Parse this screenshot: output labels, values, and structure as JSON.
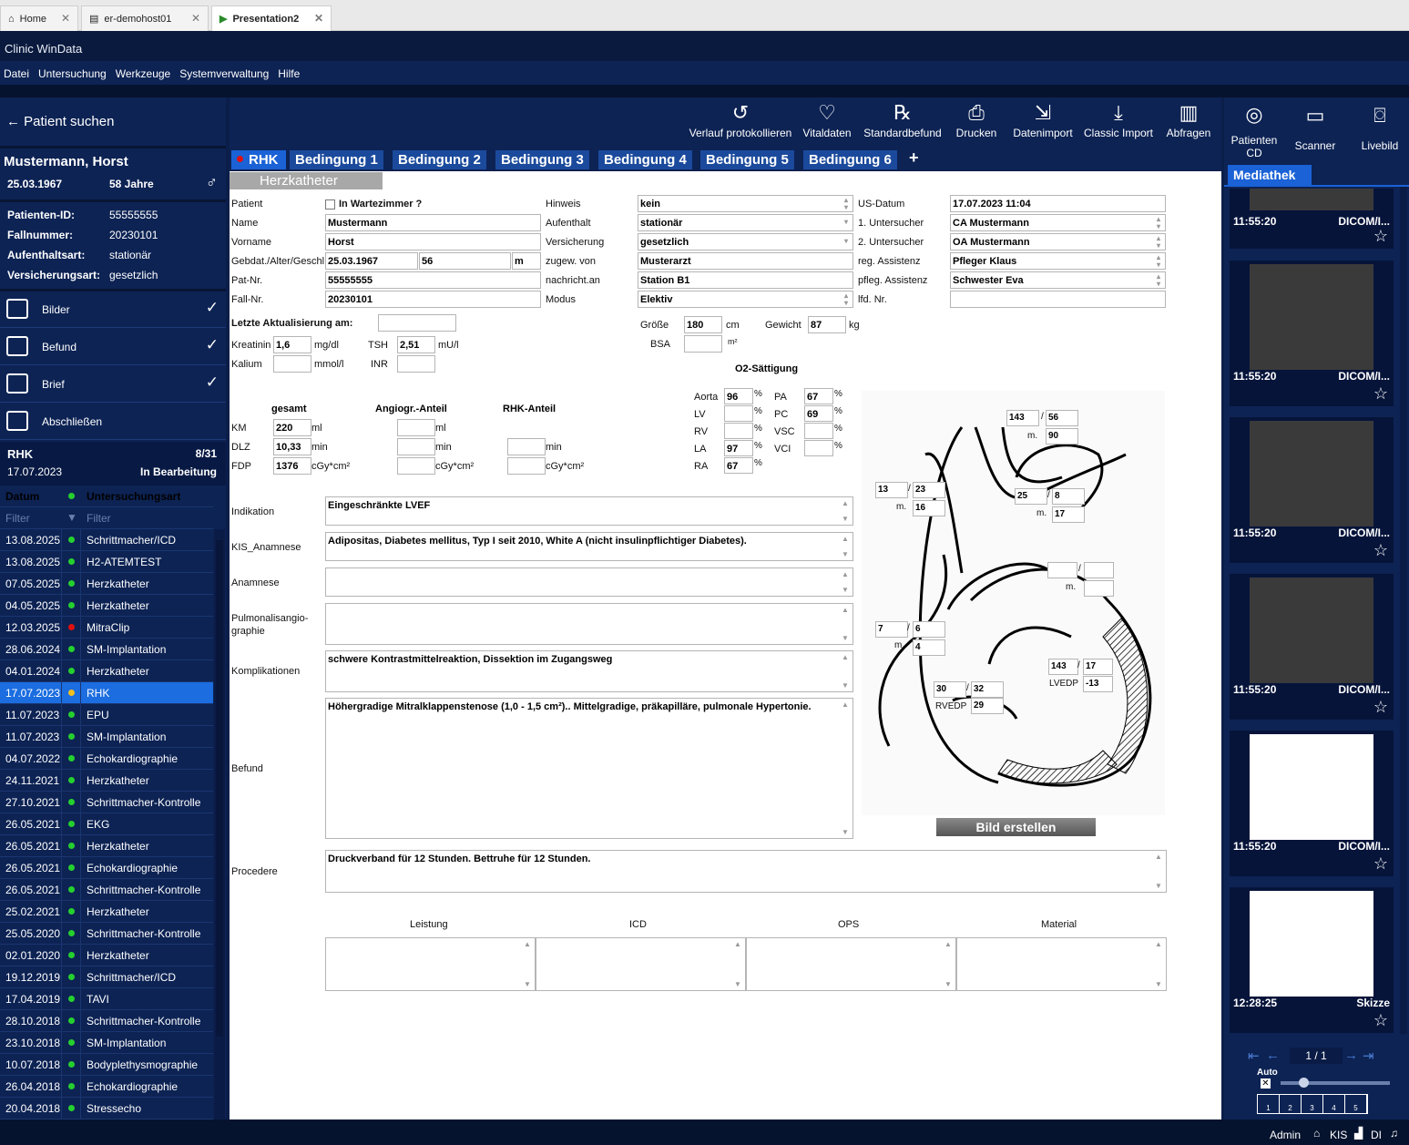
{
  "browser_tabs": [
    {
      "label": "Home"
    },
    {
      "label": "er-demohost01"
    },
    {
      "label": "Presentation2"
    }
  ],
  "app_title": "Clinic WinData",
  "menu": [
    "Datei",
    "Untersuchung",
    "Werkzeuge",
    "Systemverwaltung",
    "Hilfe"
  ],
  "sidebar": {
    "search": "Patient suchen",
    "patient_name": "Mustermann, Horst",
    "dob": "25.03.1967",
    "age": "58 Jahre",
    "info": [
      {
        "k": "Patienten-ID:",
        "v": "55555555"
      },
      {
        "k": "Fallnummer:",
        "v": "20230101"
      },
      {
        "k": "Aufenthaltsart:",
        "v": "stationär"
      },
      {
        "k": "Versicherungsart:",
        "v": "gesetzlich"
      }
    ],
    "nav": [
      "Bilder",
      "Befund",
      "Brief",
      "Abschließen"
    ],
    "rhk": {
      "title": "RHK",
      "count": "8/31",
      "date": "17.07.2023",
      "status": "In Bearbeitung"
    },
    "list_headers": {
      "date": "Datum",
      "type": "Untersuchungsart",
      "filter": "Filter"
    },
    "exams": [
      {
        "d": "13.08.2025",
        "u": "Schrittmacher/ICD",
        "c": "#25d02e"
      },
      {
        "d": "13.08.2025",
        "u": "H2-ATEMTEST",
        "c": "#25d02e"
      },
      {
        "d": "07.05.2025",
        "u": "Herzkatheter",
        "c": "#25d02e"
      },
      {
        "d": "04.05.2025",
        "u": "Herzkatheter",
        "c": "#25d02e"
      },
      {
        "d": "12.03.2025",
        "u": "MitraClip",
        "c": "#e01010"
      },
      {
        "d": "28.06.2024",
        "u": "SM-Implantation",
        "c": "#25d02e"
      },
      {
        "d": "04.01.2024",
        "u": "Herzkatheter",
        "c": "#25d02e"
      },
      {
        "d": "17.07.2023",
        "u": "RHK",
        "c": "#f0c020"
      },
      {
        "d": "11.07.2023",
        "u": "EPU",
        "c": "#25d02e"
      },
      {
        "d": "11.07.2023",
        "u": "SM-Implantation",
        "c": "#25d02e"
      },
      {
        "d": "04.07.2022",
        "u": "Echokardiographie",
        "c": "#25d02e"
      },
      {
        "d": "24.11.2021",
        "u": "Herzkatheter",
        "c": "#25d02e"
      },
      {
        "d": "27.10.2021",
        "u": "Schrittmacher-Kontrolle",
        "c": "#25d02e"
      },
      {
        "d": "26.05.2021",
        "u": "EKG",
        "c": "#25d02e"
      },
      {
        "d": "26.05.2021",
        "u": "Herzkatheter",
        "c": "#25d02e"
      },
      {
        "d": "26.05.2021",
        "u": "Echokardiographie",
        "c": "#25d02e"
      },
      {
        "d": "26.05.2021",
        "u": "Schrittmacher-Kontrolle",
        "c": "#25d02e"
      },
      {
        "d": "25.02.2021",
        "u": "Herzkatheter",
        "c": "#25d02e"
      },
      {
        "d": "25.05.2020",
        "u": "Schrittmacher-Kontrolle",
        "c": "#25d02e"
      },
      {
        "d": "02.01.2020",
        "u": "Herzkatheter",
        "c": "#25d02e"
      },
      {
        "d": "19.12.2019",
        "u": "Schrittmacher/ICD",
        "c": "#25d02e"
      },
      {
        "d": "17.04.2019",
        "u": "TAVI",
        "c": "#25d02e"
      },
      {
        "d": "28.10.2018",
        "u": "Schrittmacher-Kontrolle",
        "c": "#25d02e"
      },
      {
        "d": "23.10.2018",
        "u": "SM-Implantation",
        "c": "#25d02e"
      },
      {
        "d": "10.07.2018",
        "u": "Bodyplethysmographie",
        "c": "#25d02e"
      },
      {
        "d": "26.04.2018",
        "u": "Echokardiographie",
        "c": "#25d02e"
      },
      {
        "d": "20.04.2018",
        "u": "Stressecho",
        "c": "#25d02e"
      }
    ]
  },
  "toolbar": [
    "Verlauf protokollieren",
    "Vitaldaten",
    "Standardbefund",
    "Drucken",
    "Datenimport",
    "Classic Import",
    "Abfragen"
  ],
  "conditions": [
    "RHK",
    "Bedingung 1",
    "Bedingung 2",
    "Bedingung 3",
    "Bedingung 4",
    "Bedingung 5",
    "Bedingung 6",
    "+"
  ],
  "form": {
    "section": "Herzkatheter",
    "labels": {
      "patient": "Patient",
      "wartezimmer": "In Wartezimmer ?",
      "name": "Name",
      "vorname": "Vorname",
      "gebdat": "Gebdat./Alter/Geschl",
      "patnr": "Pat-Nr.",
      "fallnr": "Fall-Nr.",
      "hinweis": "Hinweis",
      "aufenthalt": "Aufenthalt",
      "versicherung": "Versicherung",
      "zugew": "zugew. von",
      "nachricht": "nachricht.an",
      "modus": "Modus",
      "usdatum": "US-Datum",
      "u1": "1. Untersucher",
      "u2": "2. Untersucher",
      "regass": "reg. Assistenz",
      "pflass": "pfleg. Assistenz",
      "lfdnr": "lfd. Nr.",
      "update": "Letzte Aktualisierung am:",
      "groesse": "Größe",
      "cm": "cm",
      "gewicht": "Gewicht",
      "kg": "kg",
      "bsa": "BSA",
      "m2": "m²",
      "kreatinin": "Kreatinin",
      "mgdl": "mg/dl",
      "tsh": "TSH",
      "mul": "mU/l",
      "kalium": "Kalium",
      "mmoll": "mmol/l",
      "inr": "INR",
      "o2": "O2-Sättigung",
      "gesamt": "gesamt",
      "angio": "Angiogr.-Anteil",
      "rhkanteil": "RHK-Anteil",
      "km": "KM",
      "ml": "ml",
      "dlz": "DLZ",
      "min": "min",
      "fdp": "FDP",
      "cgy": "cGy*cm²",
      "indikation": "Indikation",
      "kis": "KIS_Anamnese",
      "anamnese": "Anamnese",
      "pulmo": "Pulmonalisangio-\ngraphie",
      "kompl": "Komplikationen",
      "befund": "Befund",
      "procedere": "Procedere",
      "leistung": "Leistung",
      "icd": "ICD",
      "ops": "OPS",
      "material": "Material",
      "bild": "Bild erstellen",
      "pct": "%"
    },
    "values": {
      "name": "Mustermann",
      "vorname": "Horst",
      "gebdat": "25.03.1967",
      "alter": "56",
      "geschl": "m",
      "patnr": "55555555",
      "fallnr": "20230101",
      "hinweis": "kein",
      "aufenthalt": "stationär",
      "versicherung": "gesetzlich",
      "zugew": "Musterarzt",
      "nachricht": "Station B1",
      "modus": "Elektiv",
      "usdatum": "17.07.2023 11:04",
      "u1": "CA Mustermann",
      "u2": "OA Mustermann",
      "regass": "Pfleger Klaus",
      "pflass": "Schwester Eva",
      "groesse": "180",
      "gewicht": "87",
      "kreatinin": "1,6",
      "tsh": "2,51",
      "km": "220",
      "dlz": "10,33",
      "fdp": "1376"
    },
    "o2": [
      {
        "k": "Aorta",
        "v": "96"
      },
      {
        "k": "LV",
        "v": ""
      },
      {
        "k": "RV",
        "v": ""
      },
      {
        "k": "LA",
        "v": "97"
      },
      {
        "k": "RA",
        "v": "67"
      }
    ],
    "o2b": [
      {
        "k": "PA",
        "v": "67"
      },
      {
        "k": "PC",
        "v": "69"
      },
      {
        "k": "VSC",
        "v": ""
      },
      {
        "k": "VCI",
        "v": ""
      }
    ],
    "texts": {
      "indikation": "Eingeschränkte LVEF",
      "kis": "Adipositas, Diabetes mellitus, Typ I seit 2010, White A (nicht insulinpflichtiger Diabetes).",
      "kompl": "schwere Kontrastmittelreaktion, Dissektion im Zugangsweg",
      "befund": "Höhergradige Mitralklappenstenose (1,0 - 1,5 cm²).. Mittelgradige, präkapilläre, pulmonale Hypertonie.",
      "procedere": "Druckverband für 12 Stunden. Bettruhe für 12 Stunden."
    },
    "diagram": {
      "ao_s": "143",
      "ao_d": "56",
      "ao_m": "90",
      "ra_s": "13",
      "ra_d": "23",
      "ra_m": "16",
      "pa_s": "25",
      "pa_d": "8",
      "pa_m": "17",
      "la_s": "7",
      "la_d": "6",
      "la_m": "4",
      "lv_s": "143",
      "lv_d": "17",
      "lvedp": "-13",
      "rv_s": "30",
      "rv_d": "32",
      "rvedp": "29",
      "m": "m.",
      "sl": "/",
      "lvedp_l": "LVEDP",
      "rvedp_l": "RVEDP"
    }
  },
  "right": {
    "tools": [
      {
        "l": "Patienten CD"
      },
      {
        "l": "Scanner"
      },
      {
        "l": "Livebild"
      }
    ],
    "tab": "Mediathek",
    "items": [
      {
        "t": "11:55:20",
        "y": "DICOM/I..."
      },
      {
        "t": "11:55:20",
        "y": "DICOM/I..."
      },
      {
        "t": "11:55:20",
        "y": "DICOM/I..."
      },
      {
        "t": "11:55:20",
        "y": "DICOM/I..."
      },
      {
        "t": "11:55:20",
        "y": "DICOM/I..."
      },
      {
        "t": "12:28:25",
        "y": "Skizze"
      }
    ],
    "page": "1 / 1",
    "auto": "Auto",
    "slots": [
      "1",
      "2",
      "3",
      "4",
      "5"
    ]
  },
  "status": {
    "user": "Admin",
    "kis": "KIS",
    "di": "DI"
  }
}
